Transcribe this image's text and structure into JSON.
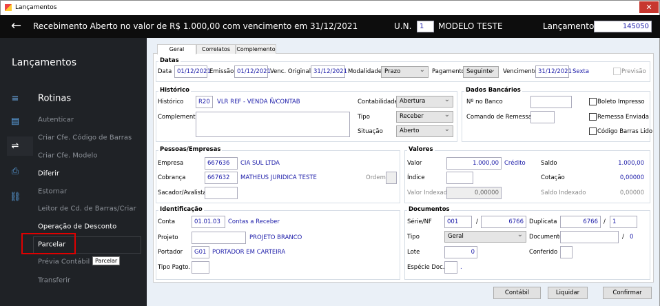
{
  "window": {
    "title": "Lançamentos",
    "close": "✕"
  },
  "header": {
    "back": "←",
    "title": "Recebimento Aberto no valor de R$ 1.000,00 com vencimento em 31/12/2021",
    "un_label": "U.N.",
    "un_value": "1",
    "un_name": "MODELO TESTE",
    "lanc_label": "Lançamento",
    "lanc_value": "145050"
  },
  "sidebar": {
    "title": "Lançamentos",
    "section": "Rotinas",
    "items": [
      {
        "label": "Autenticar",
        "enabled": false
      },
      {
        "label": "Criar Cfe. Código de Barras",
        "enabled": false
      },
      {
        "label": "Criar Cfe. Modelo",
        "enabled": false
      },
      {
        "label": "Diferir",
        "enabled": true
      },
      {
        "label": "Estornar",
        "enabled": false
      },
      {
        "label": "Leitor de Cd. de Barras/Criar",
        "enabled": false
      },
      {
        "label": "Operação de Desconto",
        "enabled": true
      },
      {
        "label": "Parcelar",
        "enabled": true
      },
      {
        "label": "Prévia Contábil",
        "enabled": false
      },
      {
        "label": "Transferir",
        "enabled": false
      }
    ],
    "tooltip": "Parcelar",
    "icons": [
      "menu-icon",
      "document-icon",
      "transfer-icon",
      "printer-icon",
      "network-icon"
    ]
  },
  "tabs": [
    "Geral",
    "Correlatos",
    "Complemento"
  ],
  "datas": {
    "title": "Datas",
    "data_label": "Data",
    "data": "01/12/2021",
    "emissao_label": "Emissão",
    "emissao": "01/12/2021",
    "venc_orig_label": "Venc. Original",
    "venc_orig": "31/12/2021",
    "modalidade_label": "Modalidade",
    "modalidade": "Prazo",
    "pagamento_label": "Pagamento",
    "pagamento": "Seguinte",
    "vencimento_label": "Vencimento",
    "vencimento": "31/12/2021",
    "dia": "Sexta",
    "previsao": "Previsão"
  },
  "historico": {
    "title": "Histórico",
    "hist_label": "Histórico",
    "hist_code": "R20",
    "hist_desc": "VLR REF - VENDA Ñ/CONTAB",
    "complemento_label": "Complemento",
    "contab_label": "Contabilidade",
    "contab": "Abertura",
    "tipo_label": "Tipo",
    "tipo": "Receber",
    "situacao_label": "Situação",
    "situacao": "Aberto"
  },
  "bancarios": {
    "title": "Dados Bancários",
    "banco_label": "Nº no Banco",
    "remessa_label": "Comando de Remessa",
    "boleto": "Boleto Impresso",
    "remessa_enviada": "Remessa Enviada",
    "codigo_lido": "Código Barras Lido"
  },
  "pessoas": {
    "title": "Pessoas/Empresas",
    "empresa_label": "Empresa",
    "empresa_code": "667636",
    "empresa_name": "CIA SUL LTDA",
    "cobranca_label": "Cobrança",
    "cobranca_code": "667632",
    "cobranca_name": "MATHEUS JURIDICA TESTE",
    "ordem_label": "Ordem",
    "sacador_label": "Sacador/Avalista"
  },
  "valores": {
    "title": "Valores",
    "valor_label": "Valor",
    "valor": "1.000,00",
    "credito": "Crédito",
    "saldo_label": "Saldo",
    "saldo": "1.000,00",
    "indice_label": "Índice",
    "cotacao_label": "Cotação",
    "cotacao": "0,00000",
    "vi_label": "Valor Indexado",
    "vi": "0,00000",
    "si_label": "Saldo Indexado",
    "si": "0,00000"
  },
  "identificacao": {
    "title": "Identificação",
    "conta_label": "Conta",
    "conta": "01.01.03",
    "conta_desc": "Contas a Receber",
    "projeto_label": "Projeto",
    "projeto_desc": "PROJETO BRANCO",
    "portador_label": "Portador",
    "portador": "G01",
    "portador_desc": "PORTADOR EM CARTEIRA",
    "tipo_pagto_label": "Tipo Pagto."
  },
  "documentos": {
    "title": "Documentos",
    "serie_label": "Série/NF",
    "serie": "001",
    "slash": "/",
    "nf": "6766",
    "duplicata_label": "Duplicata",
    "duplicata": "6766",
    "dup_parcela": "1",
    "tipo_label": "Tipo",
    "tipo": "Geral",
    "documento_label": "Documento",
    "doc_suffix": "0",
    "lote_label": "Lote",
    "lote": "0",
    "conferido_label": "Conferido",
    "especie_label": "Espécie Doc.",
    "especie_suffix": "."
  },
  "buttons": {
    "contabil": "Contábil",
    "liquidar": "Liquidar",
    "confirmar": "Confirmar"
  }
}
